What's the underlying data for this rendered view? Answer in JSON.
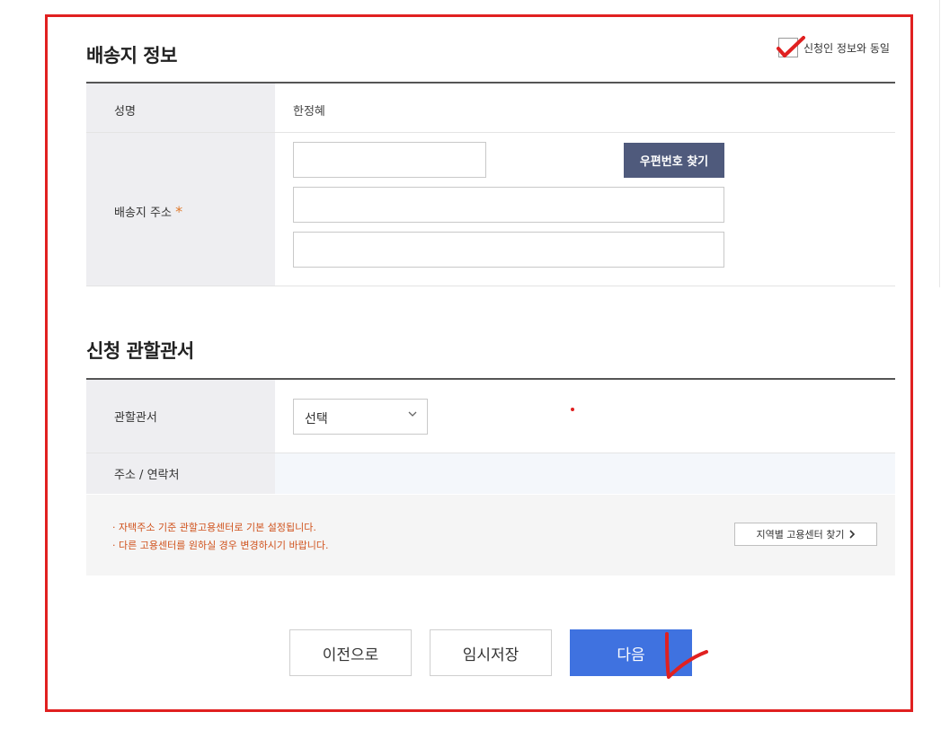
{
  "delivery": {
    "title": "배송지 정보",
    "same_as_applicant_label": "신청인 정보와 동일",
    "same_as_applicant_checked": true,
    "name_label": "성명",
    "name_value": "한정혜",
    "address_label": "배송지 주소",
    "required_mark": "*",
    "zipcode_value": "",
    "address1_value": "",
    "address2_value": "",
    "zip_search_button": "우편번호 찾기"
  },
  "office": {
    "title": "신청 관할관서",
    "office_label": "관할관서",
    "office_select_value": "선택",
    "contact_label": "주소 / 연락처",
    "contact_value": "",
    "notices": [
      "·  자택주소 기준 관할고용센터로 기본 설정됩니다.",
      "·  다른 고용센터를 원하실 경우 변경하시기 바랍니다."
    ],
    "region_search_button": "지역별 고용센터 찾기",
    "region_search_icon": "chevron-right-icon"
  },
  "actions": {
    "prev_label": "이전으로",
    "save_label": "임시저장",
    "next_label": "다음"
  },
  "colors": {
    "annotation_red": "#e02020",
    "primary_blue": "#3f72e0",
    "zip_button": "#4f5a7c",
    "notice_text": "#d0521c",
    "required": "#e07a2c"
  }
}
